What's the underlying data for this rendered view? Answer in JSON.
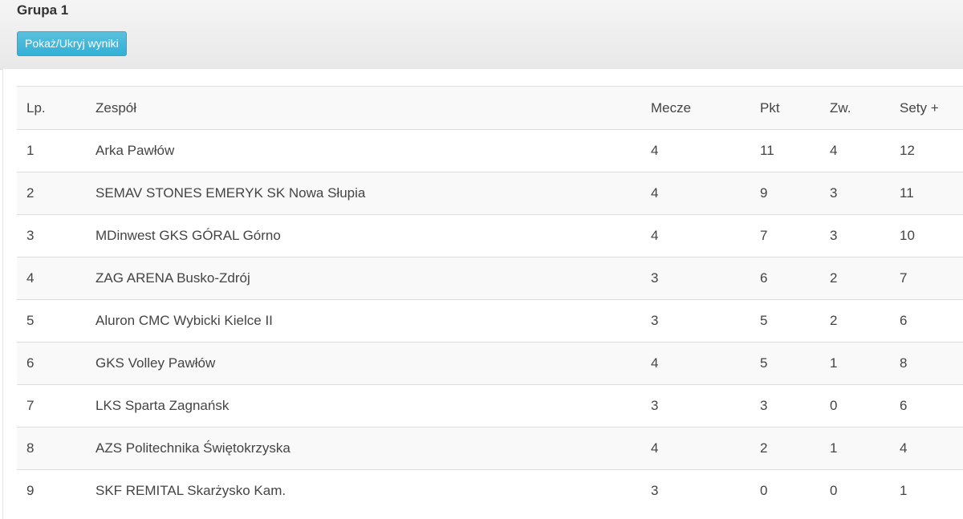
{
  "group": {
    "title": "Grupa 1",
    "toggle_label": "Pokaż/Ukryj wyniki"
  },
  "table": {
    "headers": {
      "lp": "Lp.",
      "team": "Zespół",
      "matches": "Mecze",
      "points": "Pkt",
      "wins": "Zw.",
      "sets_plus": "Sety +"
    },
    "rows": [
      {
        "lp": "1",
        "team": "Arka Pawłów",
        "matches": "4",
        "points": "11",
        "wins": "4",
        "sets_plus": "12"
      },
      {
        "lp": "2",
        "team": "SEMAV STONES EMERYK SK Nowa Słupia",
        "matches": "4",
        "points": "9",
        "wins": "3",
        "sets_plus": "11"
      },
      {
        "lp": "3",
        "team": "MDinwest GKS GÓRAL Górno",
        "matches": "4",
        "points": "7",
        "wins": "3",
        "sets_plus": "10"
      },
      {
        "lp": "4",
        "team": "ZAG ARENA Busko-Zdrój",
        "matches": "3",
        "points": "6",
        "wins": "2",
        "sets_plus": "7"
      },
      {
        "lp": "5",
        "team": "Aluron CMC Wybicki Kielce II",
        "matches": "3",
        "points": "5",
        "wins": "2",
        "sets_plus": "6"
      },
      {
        "lp": "6",
        "team": "GKS Volley Pawłów",
        "matches": "4",
        "points": "5",
        "wins": "1",
        "sets_plus": "8"
      },
      {
        "lp": "7",
        "team": "LKS Sparta Zagnańsk",
        "matches": "3",
        "points": "3",
        "wins": "0",
        "sets_plus": "6"
      },
      {
        "lp": "8",
        "team": "AZS Politechnika Świętokrzyska",
        "matches": "4",
        "points": "2",
        "wins": "1",
        "sets_plus": "4"
      },
      {
        "lp": "9",
        "team": "SKF REMITAL Skarżysko Kam.",
        "matches": "3",
        "points": "0",
        "wins": "0",
        "sets_plus": "1"
      }
    ]
  }
}
